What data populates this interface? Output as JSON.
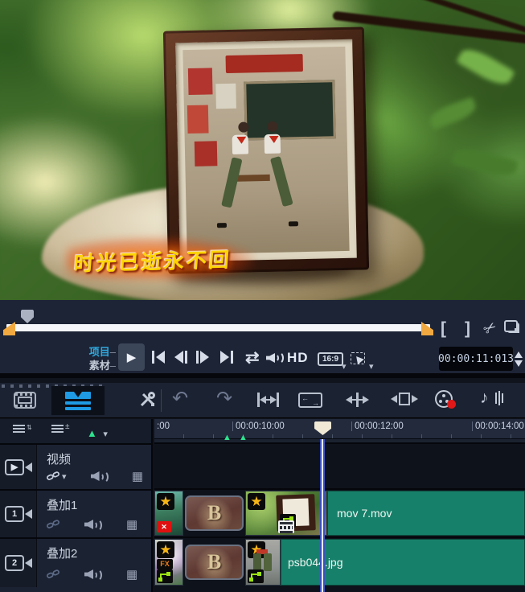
{
  "preview": {
    "overlay_text": "时光已逝永不回"
  },
  "scrub": {
    "mark_in": "[",
    "mark_out": "]"
  },
  "playback": {
    "project_label": "项目",
    "clip_label": "素材",
    "dash": "–",
    "hd_label": "HD",
    "aspect_ratio": "16:9",
    "timecode": "00:00:11:013"
  },
  "icons": {
    "play": "▶",
    "scissors": "✂",
    "undo": "↶",
    "redo": "↷",
    "loop": "⇄",
    "note": "♪",
    "star": "★",
    "grid": "▦",
    "caret": "▾",
    "cue_triangle": "▲",
    "updown": "⇅",
    "plusminus": "±",
    "arrow_left": "←",
    "arrow_right": "→",
    "mute": "✕"
  },
  "timeline": {
    "ruler_labels": [
      ":00",
      "00:00:10:00",
      "00:00:12:00",
      "00:00:14:00"
    ],
    "tracks": [
      {
        "label": "视频",
        "badge": "▶"
      },
      {
        "label": "叠加1",
        "badge": "1"
      },
      {
        "label": "叠加2",
        "badge": "2"
      }
    ],
    "overlay1": {
      "clip_name": "mov 7.mov"
    },
    "overlay2": {
      "clip_name": "psb044.jpg",
      "fx_label": "FX"
    },
    "b_thumb_letter": "B"
  },
  "colors": {
    "accent_blue": "#1e9be4",
    "mode_cyan": "#2fa9de",
    "trim_handle_orange": "#f2a940",
    "clip_teal": "#17806a",
    "cue_green": "#2de28e",
    "star_yellow": "#f8b616",
    "record_red": "#e01818",
    "panel_navy": "#1d2436"
  }
}
